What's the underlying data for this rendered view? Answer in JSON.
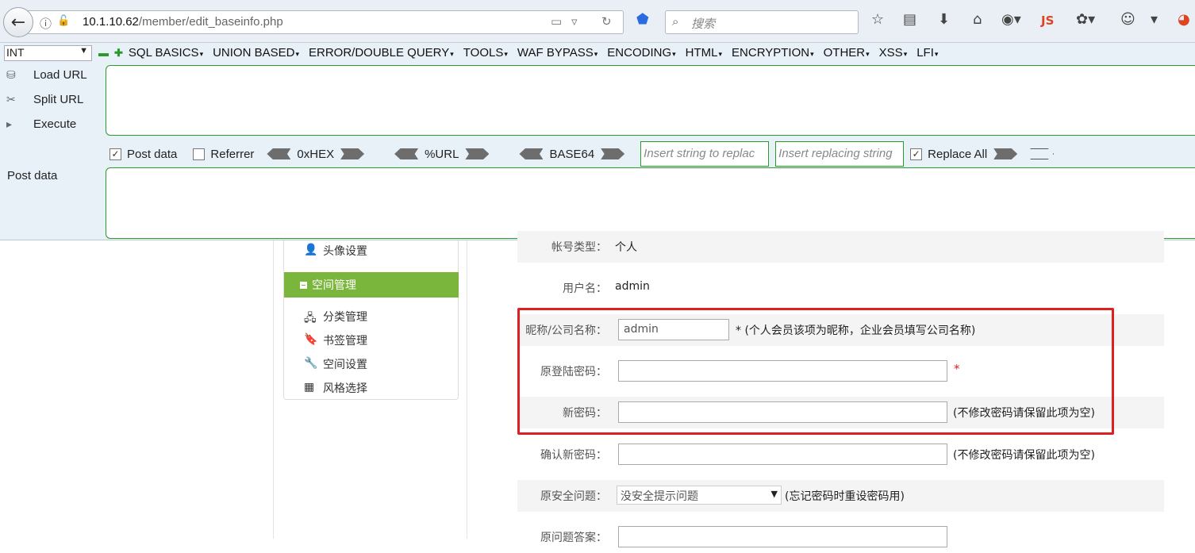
{
  "browser": {
    "url_host": "10.1.10.62",
    "url_path": "/member/edit_baseinfo.php",
    "search_placeholder": "搜索"
  },
  "hackbar": {
    "type_select": "INT",
    "menus": [
      "SQL BASICS",
      "UNION BASED",
      "ERROR/DOUBLE QUERY",
      "TOOLS",
      "WAF BYPASS",
      "ENCODING",
      "HTML",
      "ENCRYPTION",
      "OTHER",
      "XSS",
      "LFI"
    ],
    "load_url": "Load URL",
    "split_url": "Split URL",
    "execute": "Execute",
    "post_data_checkbox": "Post data",
    "post_data_checked": true,
    "referrer_checkbox": "Referrer",
    "referrer_checked": false,
    "hex_label": "0xHEX",
    "url_label": "%URL",
    "base64_label": "BASE64",
    "replace_placeholder": "Insert string to replac",
    "replacing_placeholder": "Insert replacing string",
    "replace_all_label": "Replace All",
    "replace_all_checked": true,
    "post_data_label": "Post data"
  },
  "sidebar": {
    "avatar_settings": "头像设置",
    "space_management": "空间管理",
    "items": [
      "分类管理",
      "书签管理",
      "空间设置",
      "风格选择"
    ]
  },
  "form": {
    "account_type_label": "帐号类型：",
    "account_type_value": "个人",
    "username_label": "用户名：",
    "username_value": "admin",
    "nickname_label": "昵称/公司名称：",
    "nickname_value": "admin",
    "nickname_note": "* (个人会员该项为昵称，企业会员填写公司名称)",
    "old_password_label": "原登陆密码：",
    "required_mark": "*",
    "new_password_label": "新密码：",
    "new_password_note": "(不修改密码请保留此项为空)",
    "confirm_password_label": "确认新密码：",
    "confirm_password_note": "(不修改密码请保留此项为空)",
    "security_question_label": "原安全问题：",
    "security_question_value": "没安全提示问题",
    "security_question_note": "(忘记密码时重设密码用)",
    "security_answer_label": "原问题答案："
  }
}
